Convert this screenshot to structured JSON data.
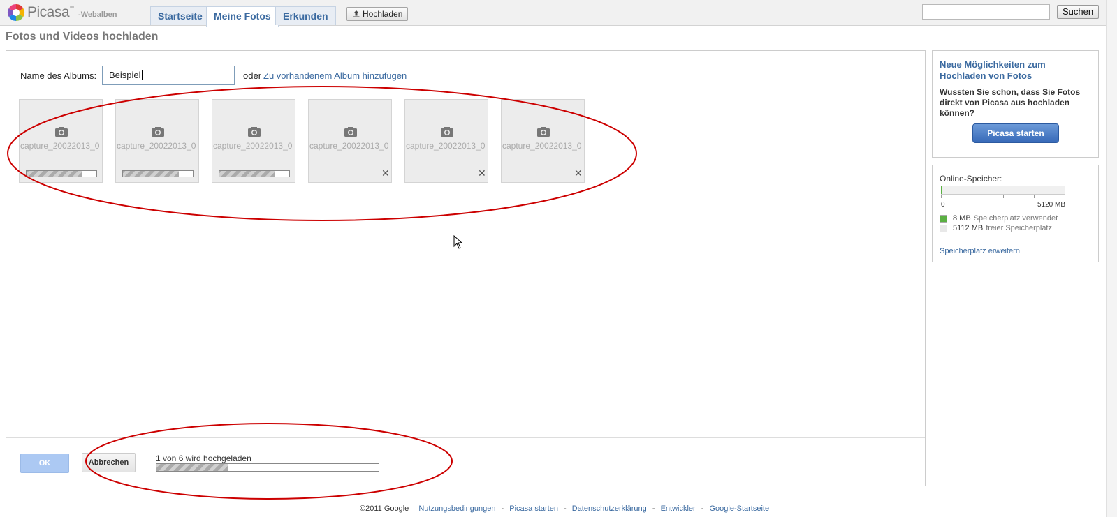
{
  "header": {
    "logo_word": "Picasa",
    "logo_tm": "™",
    "logo_sub": "-Webalben",
    "tabs": [
      {
        "label": "Startseite",
        "active": false
      },
      {
        "label": "Meine Fotos",
        "active": true
      },
      {
        "label": "Erkunden",
        "active": false
      }
    ],
    "upload_label": "Hochladen",
    "search_value": "",
    "search_button": "Suchen"
  },
  "page_title": "Fotos und Videos hochladen",
  "upload": {
    "album_label": "Name des Albums:",
    "album_value": "Beispiel",
    "or_text": "oder",
    "existing_album_link": "Zu vorhandenem Album hinzufügen",
    "files": [
      {
        "name": "capture_20022013_0",
        "state": "uploading"
      },
      {
        "name": "capture_20022013_0",
        "state": "uploading"
      },
      {
        "name": "capture_20022013_0",
        "state": "uploading"
      },
      {
        "name": "capture_20022013_0",
        "state": "queued"
      },
      {
        "name": "capture_20022013_0",
        "state": "queued"
      },
      {
        "name": "capture_20022013_0",
        "state": "queued"
      }
    ],
    "ok_label": "OK",
    "cancel_label": "Abbrechen",
    "status_text": "1 von 6 wird hochgeladen",
    "status_progress": 0.32
  },
  "promo": {
    "title": "Neue Möglichkeiten zum Hochladen von Fotos",
    "text": "Wussten Sie schon, dass Sie Fotos direkt von Picasa aus hochladen können?",
    "button": "Picasa starten"
  },
  "storage": {
    "title": "Online-Speicher:",
    "min_label": "0",
    "max_label": "5120 MB",
    "used_fraction": 0.0016,
    "used_value": "8 MB",
    "used_desc": "Speicherplatz verwendet",
    "free_value": "5112 MB",
    "free_desc": "freier Speicherplatz",
    "used_color": "#5bb043",
    "free_color": "#e8e8e8",
    "expand_link": "Speicherplatz erweitern"
  },
  "footer": {
    "copyright": "©2011 Google",
    "links": [
      "Nutzungsbedingungen",
      "Picasa starten",
      "Datenschutzerklärung",
      "Entwickler",
      "Google-Startseite"
    ]
  },
  "colors": {
    "link": "#3b6aa0",
    "annotation": "#cc0000"
  }
}
